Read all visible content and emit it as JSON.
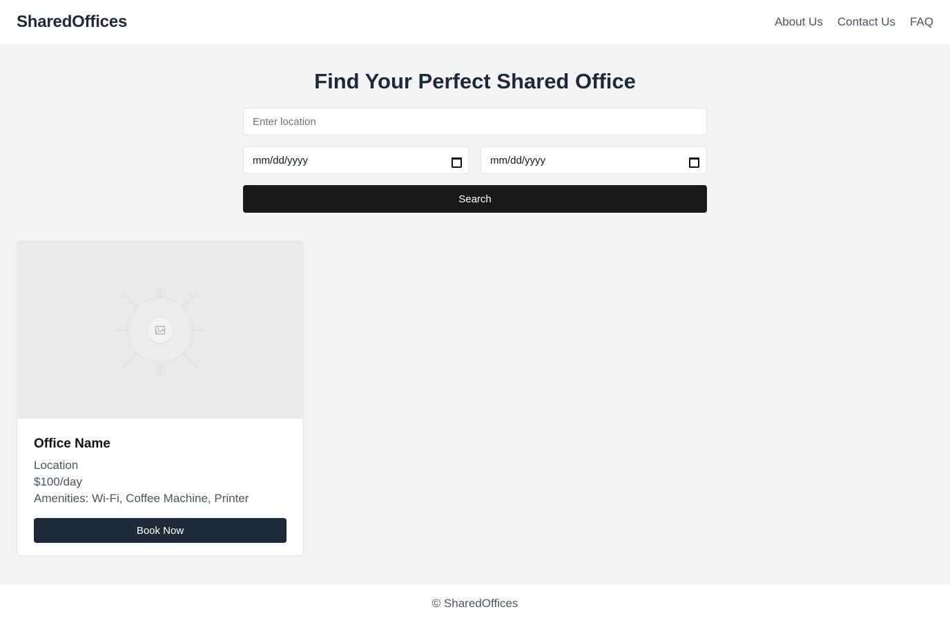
{
  "header": {
    "brand": "SharedOffices",
    "nav": [
      "About Us",
      "Contact Us",
      "FAQ"
    ]
  },
  "hero": {
    "title": "Find Your Perfect Shared Office"
  },
  "search": {
    "location_placeholder": "Enter location",
    "start_date_placeholder": "mm/dd/yyyy",
    "end_date_placeholder": "mm/dd/yyyy",
    "button_label": "Search",
    "calendar_icon": "calendar-icon"
  },
  "listing": {
    "image_icon": "image-placeholder-icon",
    "name": "Office Name",
    "location": "Location",
    "price": "$100/day",
    "amenities": "Amenities: Wi-Fi, Coffee Machine, Printer",
    "button_label": "Book Now"
  },
  "footer": {
    "text": "© SharedOffices"
  },
  "colors": {
    "background": "#f2f4f6",
    "search_button": "#18181b",
    "book_button": "#1f2937"
  }
}
